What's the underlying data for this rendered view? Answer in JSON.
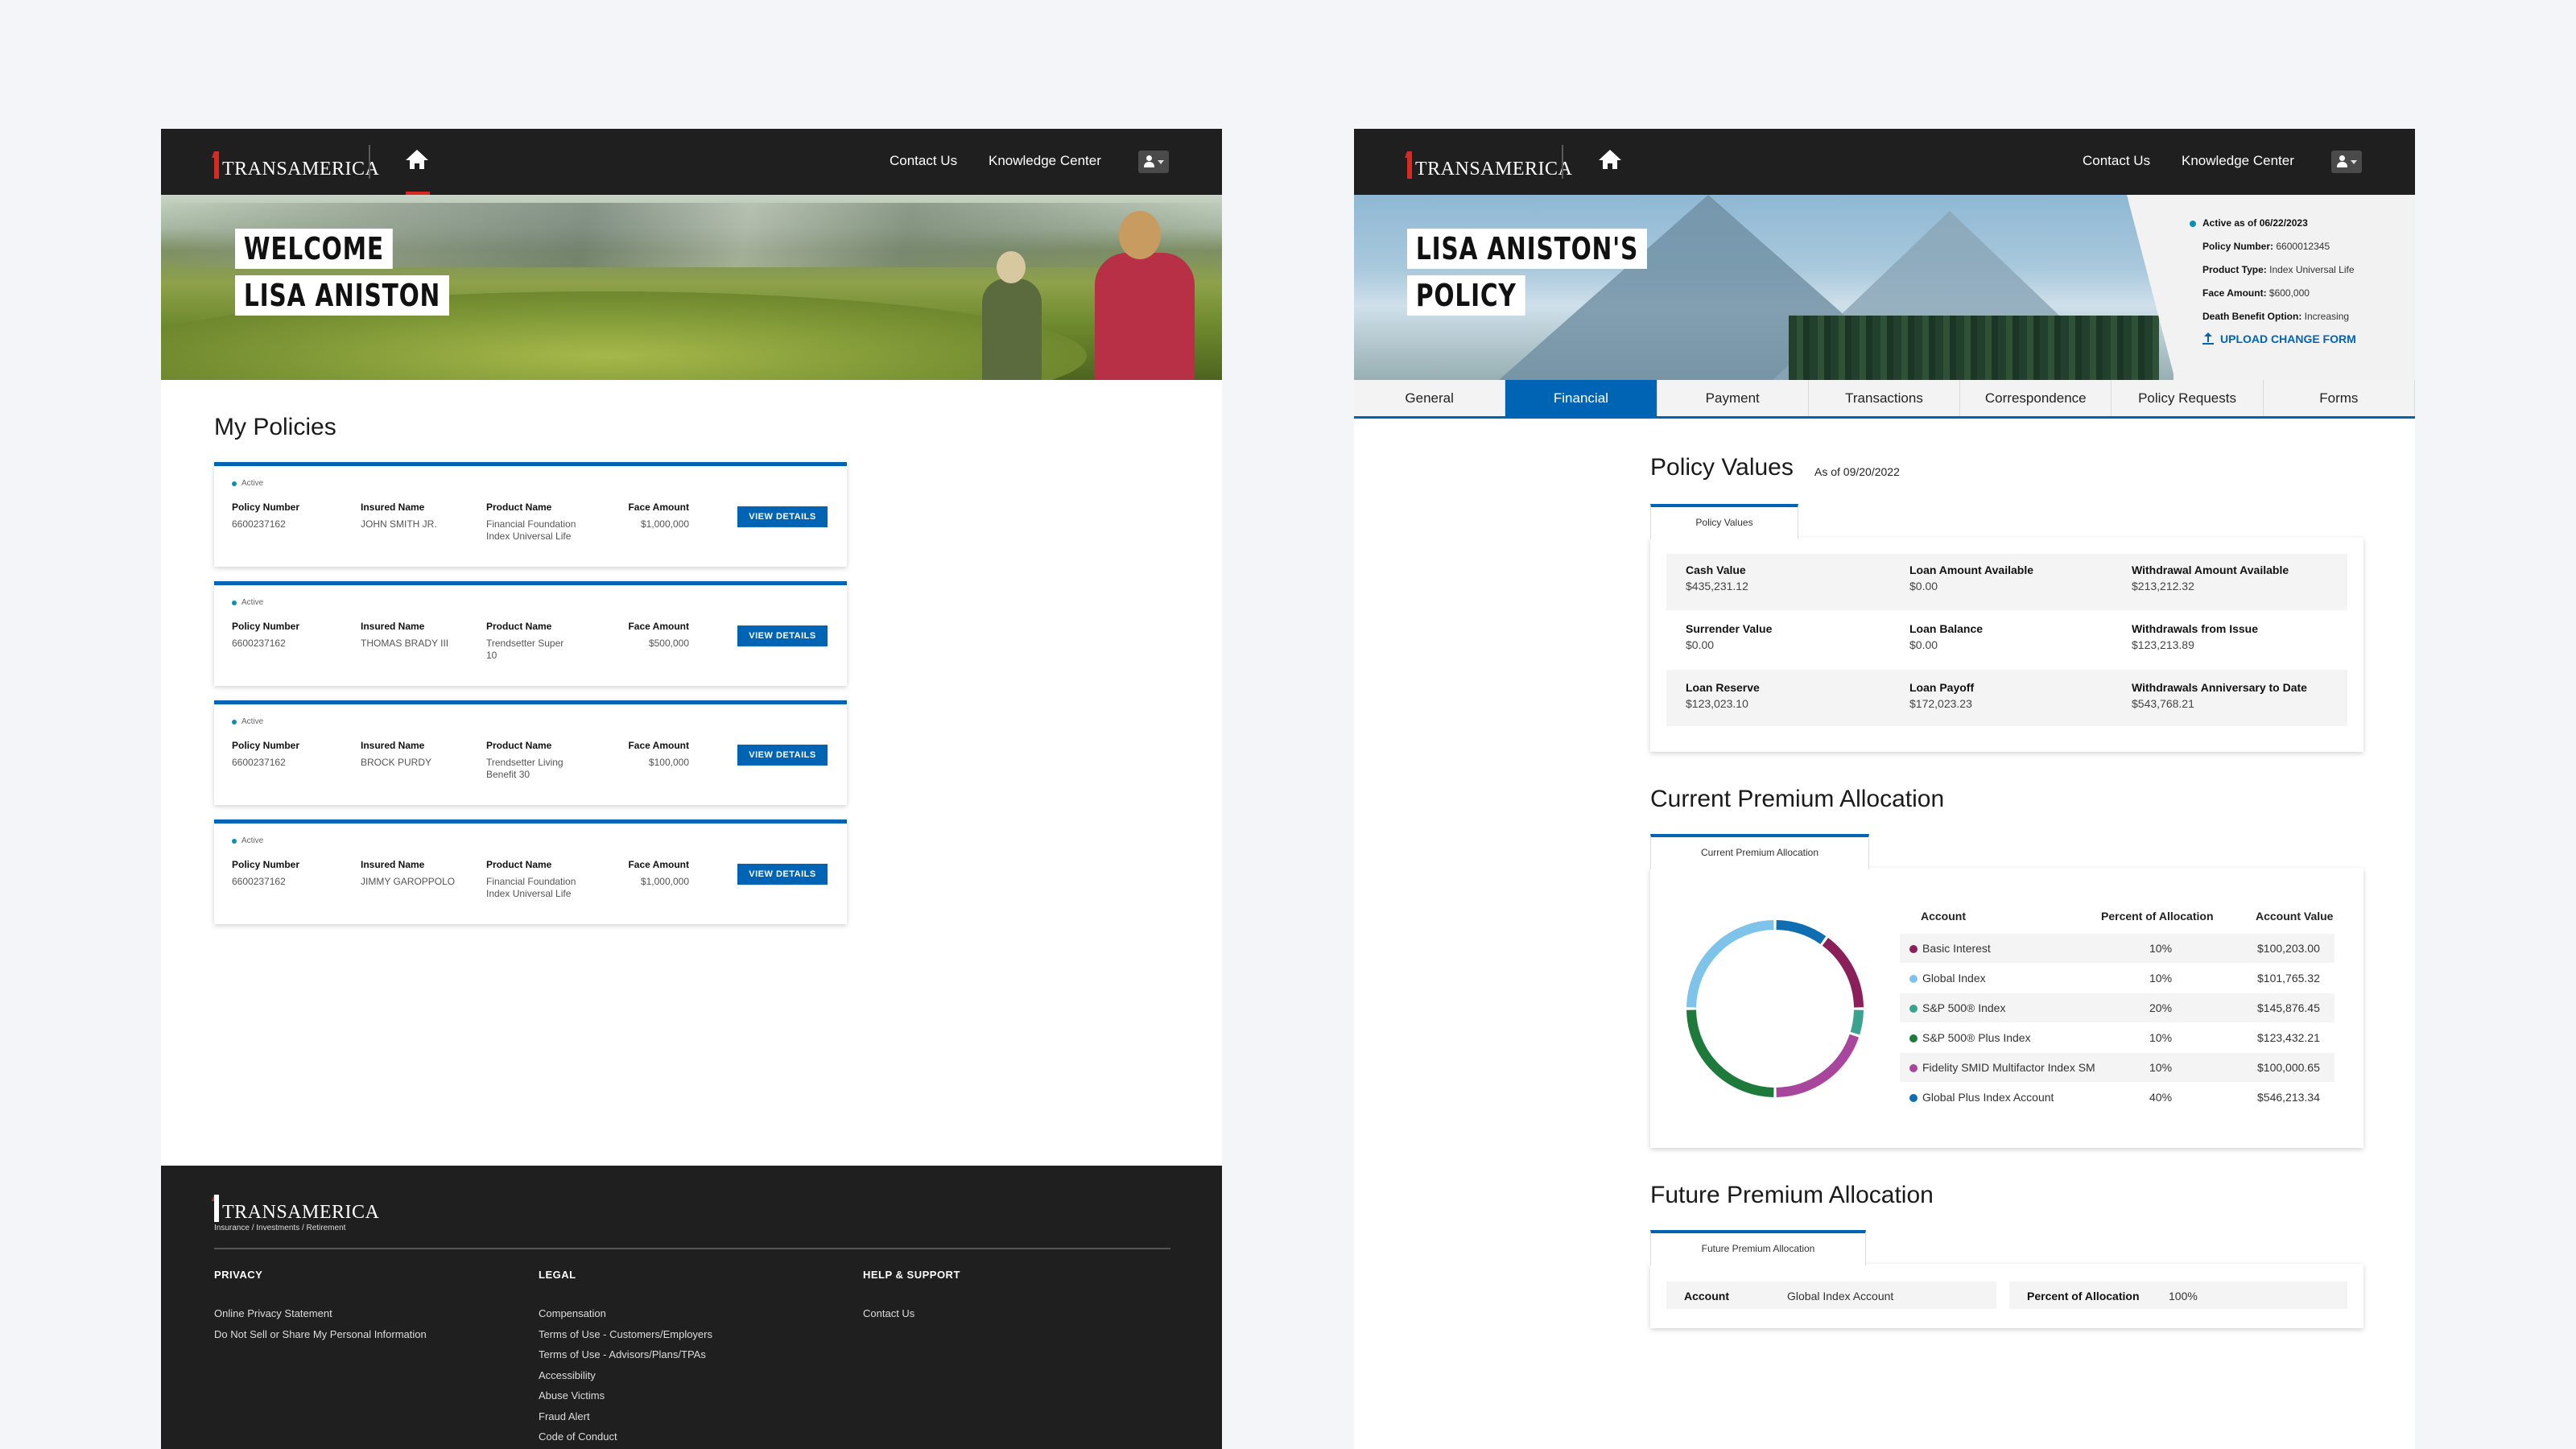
{
  "nav": {
    "brand": "TRANSAMERICA",
    "contact_us": "Contact Us",
    "knowledge_center": "Knowledge Center"
  },
  "welcome": {
    "line1": "WELCOME",
    "line2": "LISA ANISTON"
  },
  "my_policies": {
    "title": "My Policies",
    "labels": {
      "status": "Active",
      "policy_number": "Policy Number",
      "insured_name": "Insured Name",
      "product_name": "Product Name",
      "face_amount": "Face Amount",
      "button": "VIEW DETAILS"
    },
    "cards": [
      {
        "policy_number": "6600237162",
        "insured_name": "JOHN SMITH JR.",
        "product_name_1": "Financial Foundation",
        "product_name_2": "Index Universal Life",
        "face_amount": "$1,000,000"
      },
      {
        "policy_number": "6600237162",
        "insured_name": "THOMAS BRADY III",
        "product_name_1": "Trendsetter Super",
        "product_name_2": "10",
        "face_amount": "$500,000"
      },
      {
        "policy_number": "6600237162",
        "insured_name": "BROCK PURDY",
        "product_name_1": "Trendsetter Living",
        "product_name_2": "Benefit 30",
        "face_amount": "$100,000"
      },
      {
        "policy_number": "6600237162",
        "insured_name": "JIMMY GAROPPOLO",
        "product_name_1": "Financial Foundation",
        "product_name_2": "Index Universal Life",
        "face_amount": "$1,000,000"
      }
    ]
  },
  "footer": {
    "brand": "TRANSAMERICA",
    "tagline": "Insurance / Investments / Retirement",
    "privacy": {
      "heading": "PRIVACY",
      "links": [
        "Online Privacy Statement",
        "Do Not Sell or Share My Personal Information"
      ]
    },
    "legal": {
      "heading": "LEGAL",
      "links": [
        "Compensation",
        "Terms of Use - Customers/Employers",
        "Terms of Use - Advisors/Plans/TPAs",
        "Accessibility",
        "Abuse Victims",
        "Fraud Alert",
        "Code of Conduct"
      ]
    },
    "help": {
      "heading": "HELP & SUPPORT",
      "links": [
        "Contact Us"
      ]
    }
  },
  "policy_header": {
    "line1": "LISA ANISTON'S",
    "line2": "POLICY",
    "status": "Active as of 06/22/2023",
    "policy_number_label": "Policy Number:",
    "policy_number": "6600012345",
    "product_type_label": "Product Type:",
    "product_type": "Index Universal Life",
    "face_amount_label": "Face Amount:",
    "face_amount": "$600,000",
    "dbo_label": "Death Benefit Option:",
    "dbo": "Increasing",
    "upload": "UPLOAD CHANGE FORM"
  },
  "tabs": [
    "General",
    "Financial",
    "Payment",
    "Transactions",
    "Correspondence",
    "Policy Requests",
    "Forms"
  ],
  "policy_values": {
    "title": "Policy Values",
    "as_of": "As of 09/20/2022",
    "tab": "Policy Values",
    "items": [
      {
        "label": "Cash Value",
        "value": "$435,231.12"
      },
      {
        "label": "Loan Amount Available",
        "value": "$0.00"
      },
      {
        "label": "Withdrawal Amount Available",
        "value": "$213,212.32"
      },
      {
        "label": "Surrender Value",
        "value": "$0.00"
      },
      {
        "label": "Loan Balance",
        "value": "$0.00"
      },
      {
        "label": "Withdrawals from Issue",
        "value": "$123,213.89"
      },
      {
        "label": "Loan Reserve",
        "value": "$123,023.10"
      },
      {
        "label": "Loan Payoff",
        "value": "$172,023.23"
      },
      {
        "label": "Withdrawals Anniversary to Date",
        "value": "$543,768.21"
      }
    ]
  },
  "current_allocation": {
    "title": "Current Premium Allocation",
    "tab": "Current Premium Allocation",
    "headers": {
      "account": "Account",
      "percent": "Percent of Allocation",
      "value": "Account Value"
    },
    "rows": [
      {
        "account": "Basic Interest",
        "percent": "10%",
        "value": "$100,203.00",
        "color": "#8a1f5a"
      },
      {
        "account": "Global Index",
        "percent": "10%",
        "value": "$101,765.32",
        "color": "#7ec4ea"
      },
      {
        "account": "S&P 500® Index",
        "percent": "20%",
        "value": "$145,876.45",
        "color": "#3aa38f"
      },
      {
        "account": "S&P 500® Plus Index",
        "percent": "10%",
        "value": "$123,432.21",
        "color": "#1d7a3a"
      },
      {
        "account": "Fidelity SMID Multifactor Index SM",
        "percent": "10%",
        "value": "$100,000.65",
        "color": "#a8469e"
      },
      {
        "account": "Global Plus Index Account",
        "percent": "40%",
        "value": "$546,213.34",
        "color": "#0f6eb2"
      }
    ]
  },
  "future_allocation": {
    "title": "Future Premium Allocation",
    "tab": "Future Premium Allocation",
    "account_label": "Account",
    "account_value": "Global Index Account",
    "percent_label": "Percent of Allocation",
    "percent_value": "100%"
  },
  "colors": {
    "brand_blue": "#0064b4",
    "nav_dark": "#1f1f1f",
    "brand_red": "#d62a22",
    "active_dot": "#0c8fb0"
  },
  "chart_data": {
    "type": "pie",
    "categories": [
      "Global Plus Index Account",
      "Basic Interest",
      "S&P 500® Index",
      "Fidelity SMID Multifactor Index SM",
      "S&P 500® Plus Index",
      "Global Index"
    ],
    "values": [
      10,
      15,
      5,
      20,
      25,
      25
    ],
    "colors": [
      "#0f6eb2",
      "#8a1f5a",
      "#3aa38f",
      "#a8469e",
      "#1d7a3a",
      "#7ec4ea"
    ]
  }
}
